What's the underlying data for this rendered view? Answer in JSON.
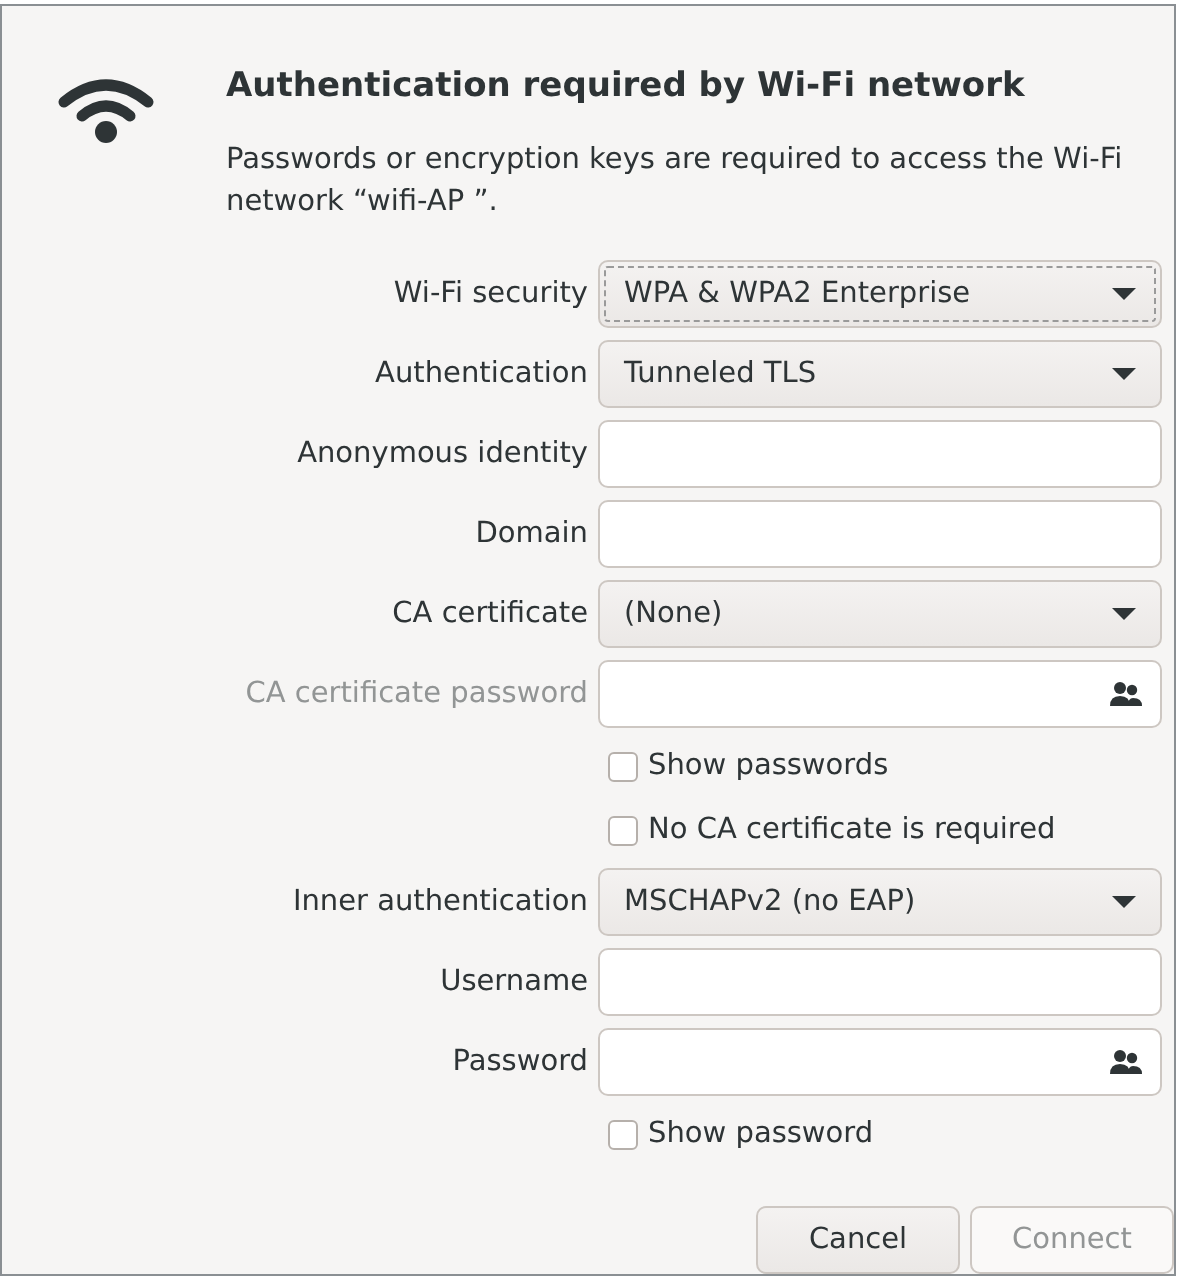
{
  "dialog": {
    "title": "Authentication required by Wi-Fi network",
    "message": "Passwords or encryption keys are required to access the Wi-Fi network “wifi-AP ”."
  },
  "fields": [
    {
      "kind": "dropdown",
      "label": "Wi-Fi security",
      "value": "WPA & WPA2 Enterprise",
      "focused": true,
      "disabled": false
    },
    {
      "kind": "dropdown",
      "label": "Authentication",
      "value": "Tunneled TLS",
      "focused": false,
      "disabled": false
    },
    {
      "kind": "entry",
      "label": "Anonymous identity",
      "disabled": false
    },
    {
      "kind": "entry",
      "label": "Domain",
      "disabled": false
    },
    {
      "kind": "dropdown",
      "label": "CA certificate",
      "value": "(None)",
      "focused": false,
      "disabled": false
    },
    {
      "kind": "password",
      "label": "CA certificate password",
      "disabled": true
    },
    {
      "kind": "checkbox",
      "label": "Show passwords",
      "checked": false
    },
    {
      "kind": "checkbox",
      "label": "No CA certificate is required",
      "checked": false
    },
    {
      "kind": "dropdown",
      "label": "Inner authentication",
      "value": "MSCHAPv2 (no EAP)",
      "focused": false,
      "disabled": false
    },
    {
      "kind": "entry",
      "label": "Username",
      "disabled": false
    },
    {
      "kind": "password",
      "label": "Password",
      "disabled": false
    },
    {
      "kind": "checkbox",
      "label": "Show password",
      "checked": false
    }
  ],
  "buttons": [
    {
      "label": "Cancel",
      "disabled": false
    },
    {
      "label": "Connect",
      "disabled": true
    }
  ]
}
